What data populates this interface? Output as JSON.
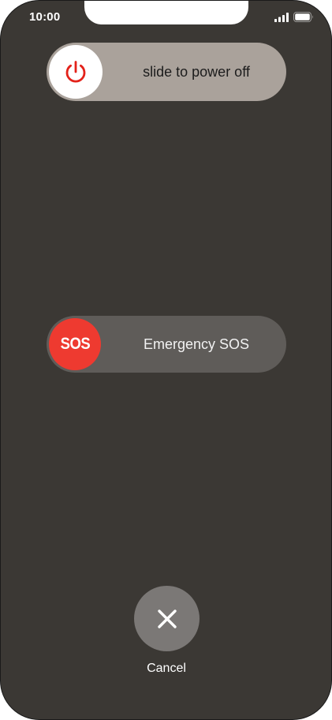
{
  "status_bar": {
    "time": "10:00",
    "icons": [
      "signal-icon",
      "battery-icon"
    ]
  },
  "power_slider": {
    "label": "slide to power off",
    "icon": "power-icon",
    "icon_color": "#e3221a"
  },
  "sos_slider": {
    "knob_text": "SOS",
    "label": "Emergency SOS",
    "knob_color": "#ee3a30"
  },
  "cancel": {
    "label": "Cancel",
    "icon": "close-icon"
  },
  "colors": {
    "background": "#3b3834",
    "power_track": "#aaa29b",
    "sos_track": "#5f5c59",
    "cancel_button": "#7b7876"
  }
}
